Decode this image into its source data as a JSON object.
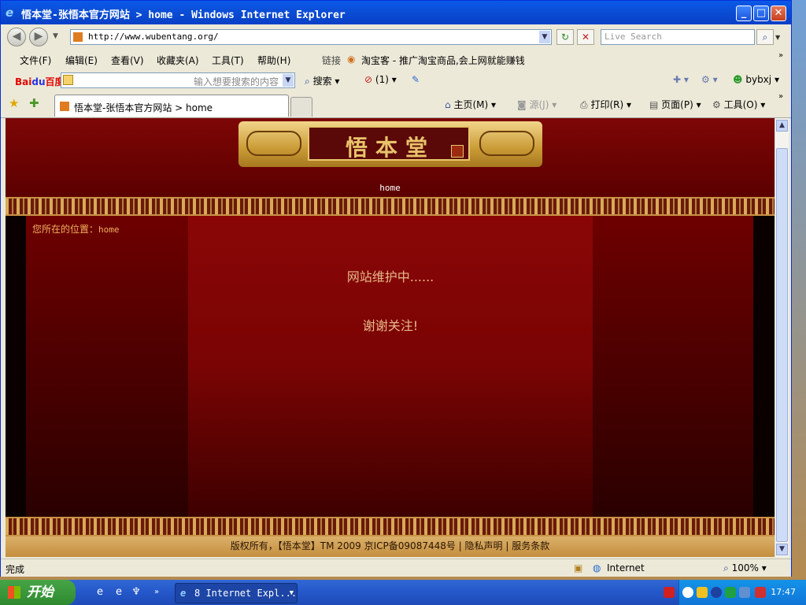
{
  "window": {
    "title": "悟本堂-张悟本官方网站 > home - Windows Internet Explorer",
    "minimize": "_",
    "maximize": "□",
    "close": "✕"
  },
  "address": {
    "url": "http://www.wubentang.org/",
    "live_search_placeholder": "Live Search"
  },
  "menu": {
    "items": [
      "文件(F)",
      "编辑(E)",
      "查看(V)",
      "收藏夹(A)",
      "工具(T)",
      "帮助(H)"
    ],
    "links_label": "链接",
    "link_item": "淘宝客 - 推广淘宝商品,会上网就能赚钱"
  },
  "baidu": {
    "logo_a": "Bai",
    "logo_b": "du",
    "logo_c": "百度",
    "input_placeholder": "输入想要搜索的内容",
    "search_label": "搜索",
    "popup_count": "(1)",
    "user": "bybxj"
  },
  "tabs": {
    "active_title": "悟本堂-张悟本官方网站 > home"
  },
  "command_bar": {
    "home": "主页(M)",
    "feeds": "源(J)",
    "print": "打印(R)",
    "page": "页面(P)",
    "tools": "工具(O)"
  },
  "page": {
    "logo_text": "悟本堂",
    "nav_home": "home",
    "location_label": "您所在的位置：",
    "location_link": "home",
    "msg1": "网站维护中......",
    "msg2": "谢谢关注!",
    "footer": "版权所有，【悟本堂】TM 2009 京ICP备09087448号   |   隐私声明   |   服务条款"
  },
  "status": {
    "text": "完成",
    "zone": "Internet",
    "zoom": "100%"
  },
  "taskbar": {
    "start": "开始",
    "task_label": "8 Internet Expl...",
    "clock": "17:47"
  },
  "colors": {
    "title_blue": "#0b4fd8",
    "page_red": "#7a0404",
    "gold": "#c99b36"
  }
}
